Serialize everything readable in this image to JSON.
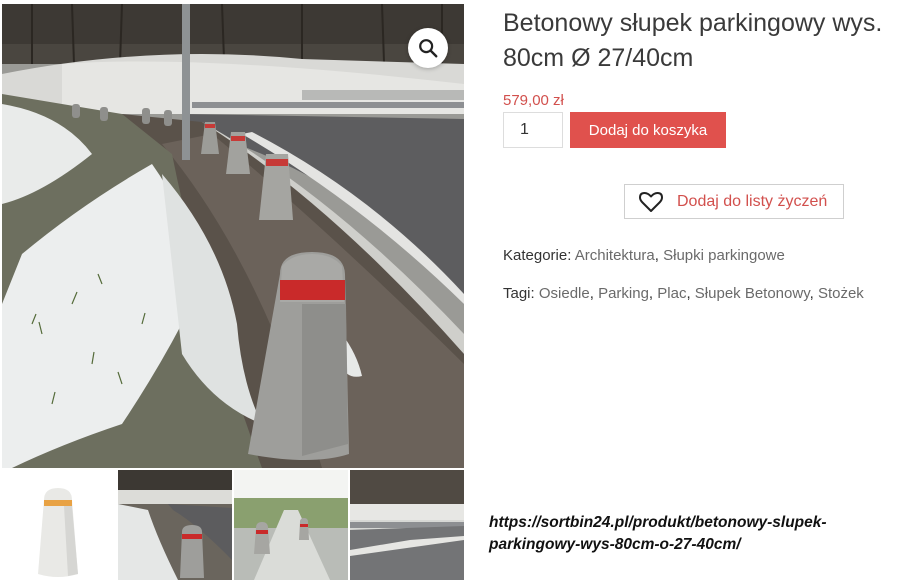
{
  "product": {
    "title": "Betonowy słupek parkingowy wys. 80cm Ø 27/40cm",
    "price": "579,00 zł",
    "quantity": "1",
    "add_to_cart_label": "Dodaj do koszyka",
    "wishlist_label": "Dodaj do listy życzeń",
    "categories_label": "Kategorie:",
    "categories": [
      "Architektura",
      "Słupki parkingowe"
    ],
    "tags_label": "Tagi:",
    "tags": [
      "Osiedle",
      "Parking",
      "Plac",
      "Słupek Betonowy",
      "Stożek"
    ]
  },
  "gallery": {
    "zoom_icon": "magnifier-icon",
    "thumbnails": [
      "bollard-white-background",
      "bollards-along-road",
      "bollards-on-path",
      "road-with-guardrail"
    ]
  },
  "source_url": "https://sortbin24.pl/produkt/betonowy-slupek-parkingowy-wys-80cm-o-27-40cm/",
  "colors": {
    "accent": "#e0514d",
    "price": "#d2504d",
    "link": "#6a6a6a"
  }
}
